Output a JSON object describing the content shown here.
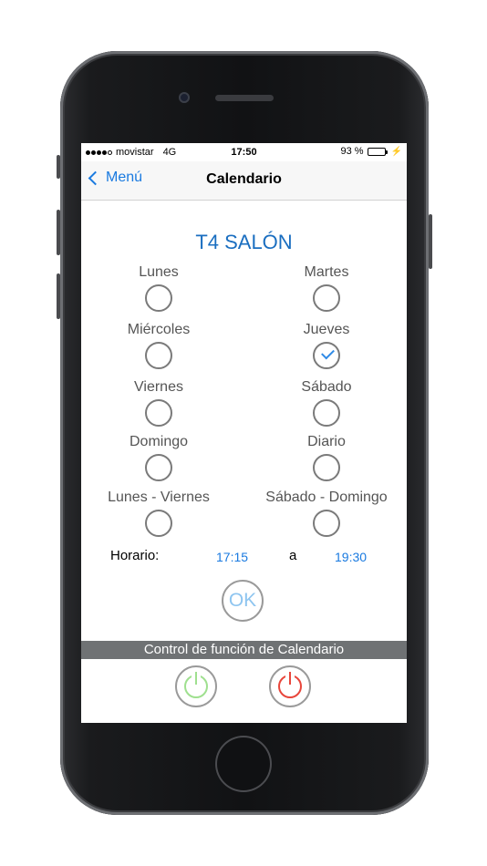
{
  "status_bar": {
    "carrier": "movistar",
    "network": "4G",
    "time": "17:50",
    "battery": "93 %",
    "battery_color": "#4cd964",
    "signal_bars_filled": 4,
    "signal_bars_total": 5
  },
  "navbar": {
    "back_label": "Menú",
    "title": "Calendario",
    "accent": "#1a7ae0"
  },
  "device_title": "T4 SALÓN",
  "days": [
    {
      "label": "Lunes",
      "checked": false
    },
    {
      "label": "Martes",
      "checked": false
    },
    {
      "label": "Miércoles",
      "checked": false
    },
    {
      "label": "Jueves",
      "checked": true
    },
    {
      "label": "Viernes",
      "checked": false
    },
    {
      "label": "Sábado",
      "checked": false
    },
    {
      "label": "Domingo",
      "checked": false
    },
    {
      "label": "Diario",
      "checked": false
    },
    {
      "label": "Lunes - Viernes",
      "checked": false
    },
    {
      "label": "Sábado - Domingo",
      "checked": false
    }
  ],
  "schedule": {
    "label": "Horario:",
    "start": "17:15",
    "separator": "a",
    "end": "19:30"
  },
  "ok_label": "OK",
  "control": {
    "title": "Control de función de Calendario",
    "on_icon": "power-on-icon",
    "off_icon": "power-off-icon",
    "on_color": "#9fe08f",
    "off_color": "#e8463b"
  }
}
